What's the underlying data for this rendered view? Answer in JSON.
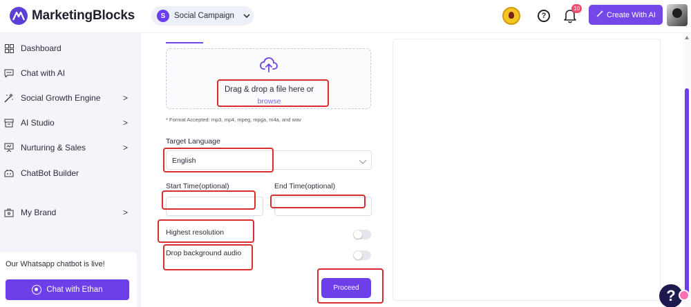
{
  "header": {
    "brand": "MarketingBlocks",
    "campaign": {
      "initial": "S",
      "name": "Social Campaign"
    },
    "notification_count": "10",
    "help_glyph": "?",
    "create_button": "Create With AI"
  },
  "sidebar": {
    "items": [
      {
        "label": "Dashboard",
        "icon": "dashboard-grid-icon",
        "has_chevron": false
      },
      {
        "label": "Chat with AI",
        "icon": "chat-bubble-icon",
        "has_chevron": false
      },
      {
        "label": "Social Growth Engine",
        "icon": "magic-wand-icon",
        "has_chevron": true
      },
      {
        "label": "AI Studio",
        "icon": "studio-icon",
        "has_chevron": true
      },
      {
        "label": "Nurturing & Sales",
        "icon": "presentation-icon",
        "has_chevron": true
      },
      {
        "label": "ChatBot Builder",
        "icon": "robot-icon",
        "has_chevron": false
      },
      {
        "label": "My Brand",
        "icon": "brand-icon",
        "has_chevron": true
      }
    ],
    "chevron": ">",
    "promo": {
      "text": "Our Whatsapp chatbot is live!",
      "button": "Chat with Ethan"
    }
  },
  "upload": {
    "title": "Drag & drop a file here or",
    "browse": "browse",
    "format_note": "* Format Accepted: mp3, mp4, mpeg, mpga, m4a, and wav"
  },
  "form": {
    "target_language_label": "Target Language",
    "target_language_value": "English",
    "start_time_label": "Start Time(optional)",
    "end_time_label": "End Time(optional)",
    "start_time_value": "",
    "end_time_value": "",
    "highest_resolution_label": "Highest resolution",
    "highest_resolution_on": false,
    "drop_bg_audio_label": "Drop background audio",
    "drop_bg_audio_on": false,
    "proceed": "Proceed"
  },
  "colors": {
    "accent": "#6c3fe8",
    "annotation": "#d92c2c",
    "notification": "#ef4b6c"
  },
  "help_bubble": "?"
}
